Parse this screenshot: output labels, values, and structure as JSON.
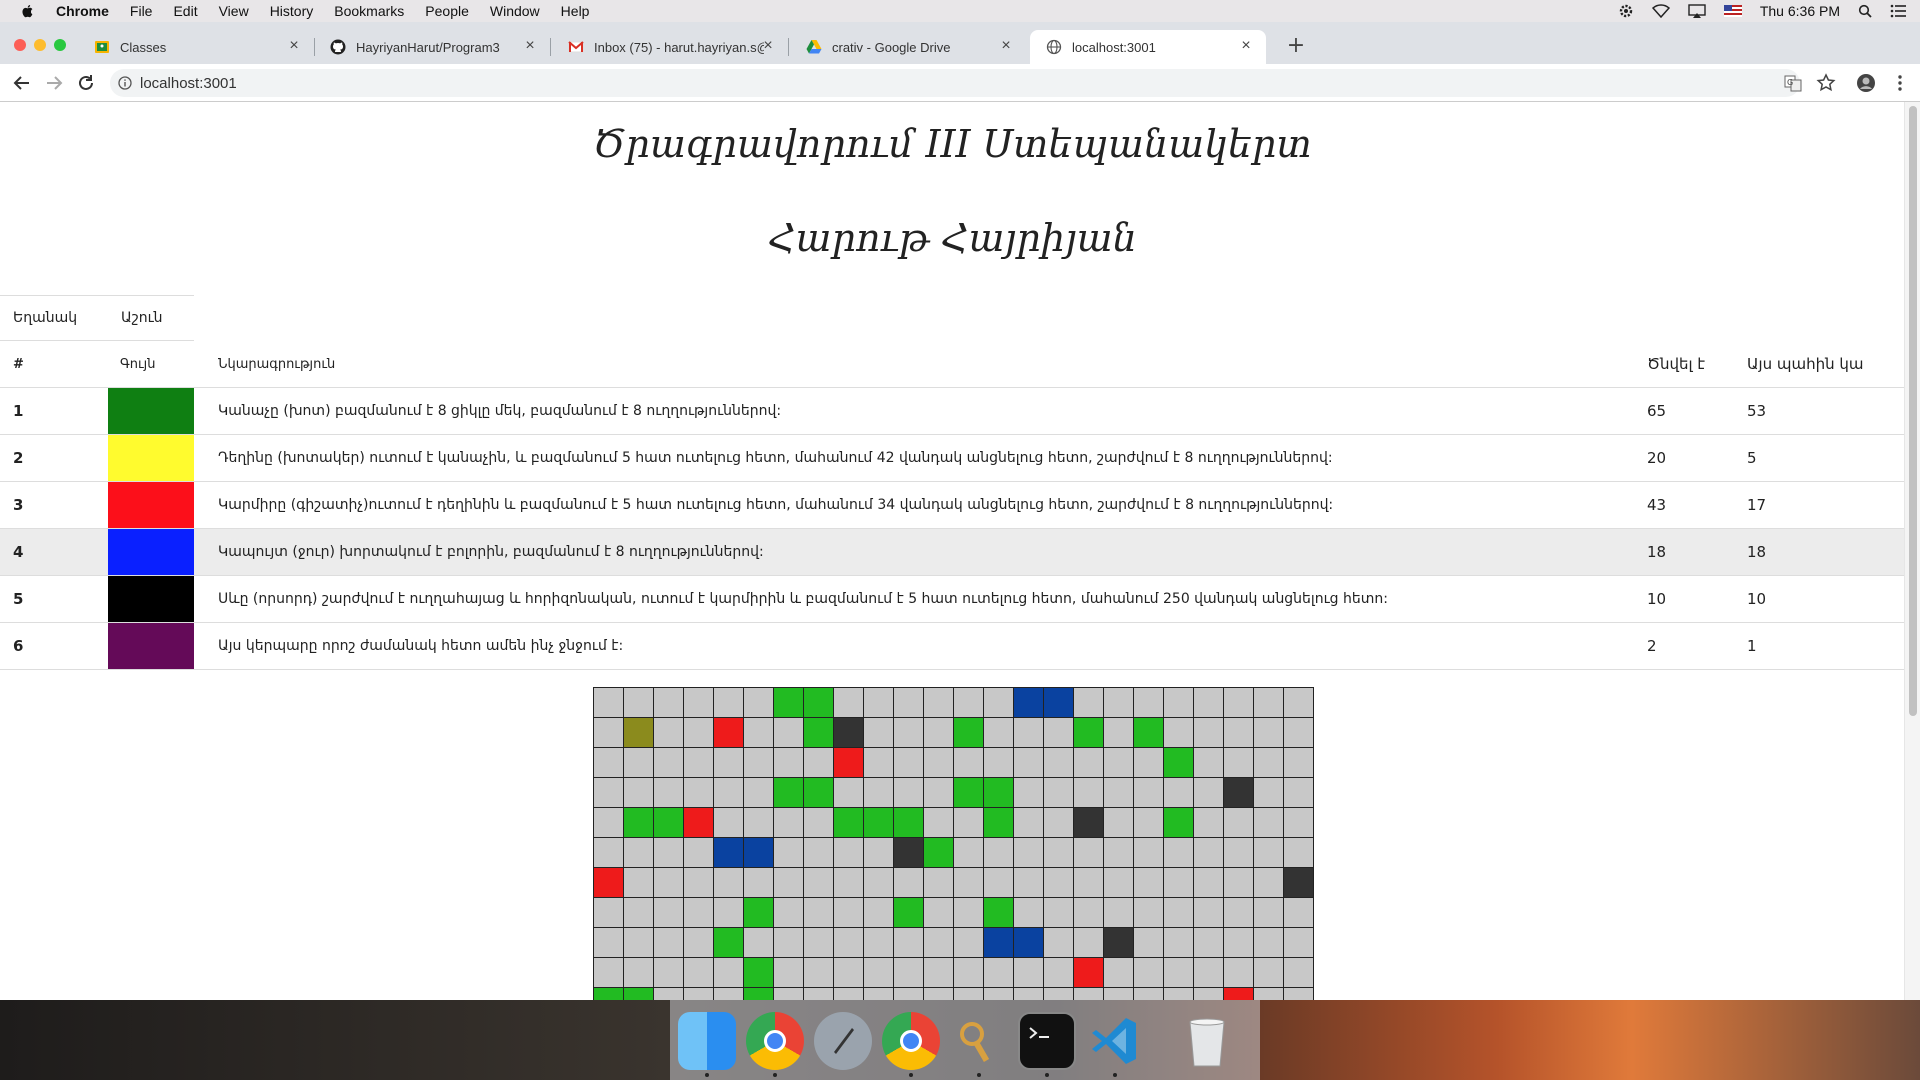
{
  "menubar": {
    "app": "Chrome",
    "items": [
      "File",
      "Edit",
      "View",
      "History",
      "Bookmarks",
      "People",
      "Window",
      "Help"
    ],
    "clock": "Thu 6:36 PM"
  },
  "tabs": [
    {
      "title": "Classes",
      "icon": "classroom-icon"
    },
    {
      "title": "HayriyanHarut/Program3",
      "icon": "github-icon"
    },
    {
      "title": "Inbox (75) - harut.hayriyan.s@",
      "icon": "gmail-icon"
    },
    {
      "title": "crativ - Google Drive",
      "icon": "drive-icon"
    },
    {
      "title": "localhost:3001",
      "icon": "globe-icon",
      "active": true
    }
  ],
  "address": {
    "url": "localhost:3001"
  },
  "page": {
    "title": "Ծրագրավորում III Ստեպանակերտ",
    "subtitle": "Հարութ Հայրիյան",
    "legend": {
      "col_sign": "Եղանակ",
      "col_season": "Աշուն"
    },
    "table": {
      "headers": {
        "id": "#",
        "color": "Գույն",
        "desc": "Նկարագրություն",
        "born": "Ծնվել է",
        "now": "Այս պահին կա"
      },
      "rows": [
        {
          "id": "1",
          "color": "#0f7f12",
          "desc": "Կանաչը (խոտ) բազմանում է 8 ցիկլը մեկ, բազմանում է 8 ուղղություններով:",
          "born": "65",
          "now": "53"
        },
        {
          "id": "2",
          "color": "#fffb2e",
          "desc": "Դեղինը (խոտակեր) ուտում է կանաչին, և բազմանում 5 հատ ուտելուց հետո, մահանում 42 վանդակ անցնելուց հետո, շարժվում է 8 ուղղություններով:",
          "born": "20",
          "now": "5"
        },
        {
          "id": "3",
          "color": "#fc0f1a",
          "desc": "Կարմիրը (գիշատիչ)ուտում է դեղինին և բազմանում է 5 հատ ուտելուց հետո, մահանում 34 վանդակ անցնելուց հետո, շարժվում է 8 ուղղություններով:",
          "born": "43",
          "now": "17"
        },
        {
          "id": "4",
          "color": "#0a20ff",
          "desc": "Կապույտ (ջուր) խորտակում է բոլորին, բազմանում է 8 ուղղություններով:",
          "born": "18",
          "now": "18"
        },
        {
          "id": "5",
          "color": "#000000",
          "desc": "Սևը (որսորդ) շարժվում է ուղղահայաց և հորիզոնական, ուտում է կարմիրին և բազմանում է 5 հատ ուտելուց հետո, մահանում 250 վանդակ անցնելուց հետո:",
          "born": "10",
          "now": "10"
        },
        {
          "id": "6",
          "color": "#640a58",
          "desc": "Այս կերպարը որոշ ժամանակ հետո ամեն ինչ ջնջում է:",
          "born": "2",
          "now": "1"
        }
      ]
    },
    "grid": {
      "cols": 24,
      "visible_rows": 11,
      "palette": {
        "0": "#c8c8c8",
        "g": "#22bb22",
        "y": "#8b8b1d",
        "r": "#ee1b1b",
        "b": "#0a42a0",
        "k": "#333333"
      },
      "rows": [
        "000000gg000000bb00000000",
        "0y00r00gk000g000g0g00000",
        "00000000r0000000000g0000",
        "000000gg0000gg0000000k00",
        "0ggr0000ggg00g00k00g0000",
        "0000bb0000kg000000000000",
        "r0000000000000000000000k",
        "00000g0000g00g0000000000",
        "0000g00000000bb00k000000",
        "00000g0000000000r0000000",
        "gg000g000000000000000r00"
      ]
    }
  },
  "dock": [
    "finder-icon",
    "chrome-icon",
    "launchpad-icon",
    "chrome-icon",
    "keychain-icon",
    "terminal-icon",
    "vscode-icon",
    "trash-icon"
  ]
}
